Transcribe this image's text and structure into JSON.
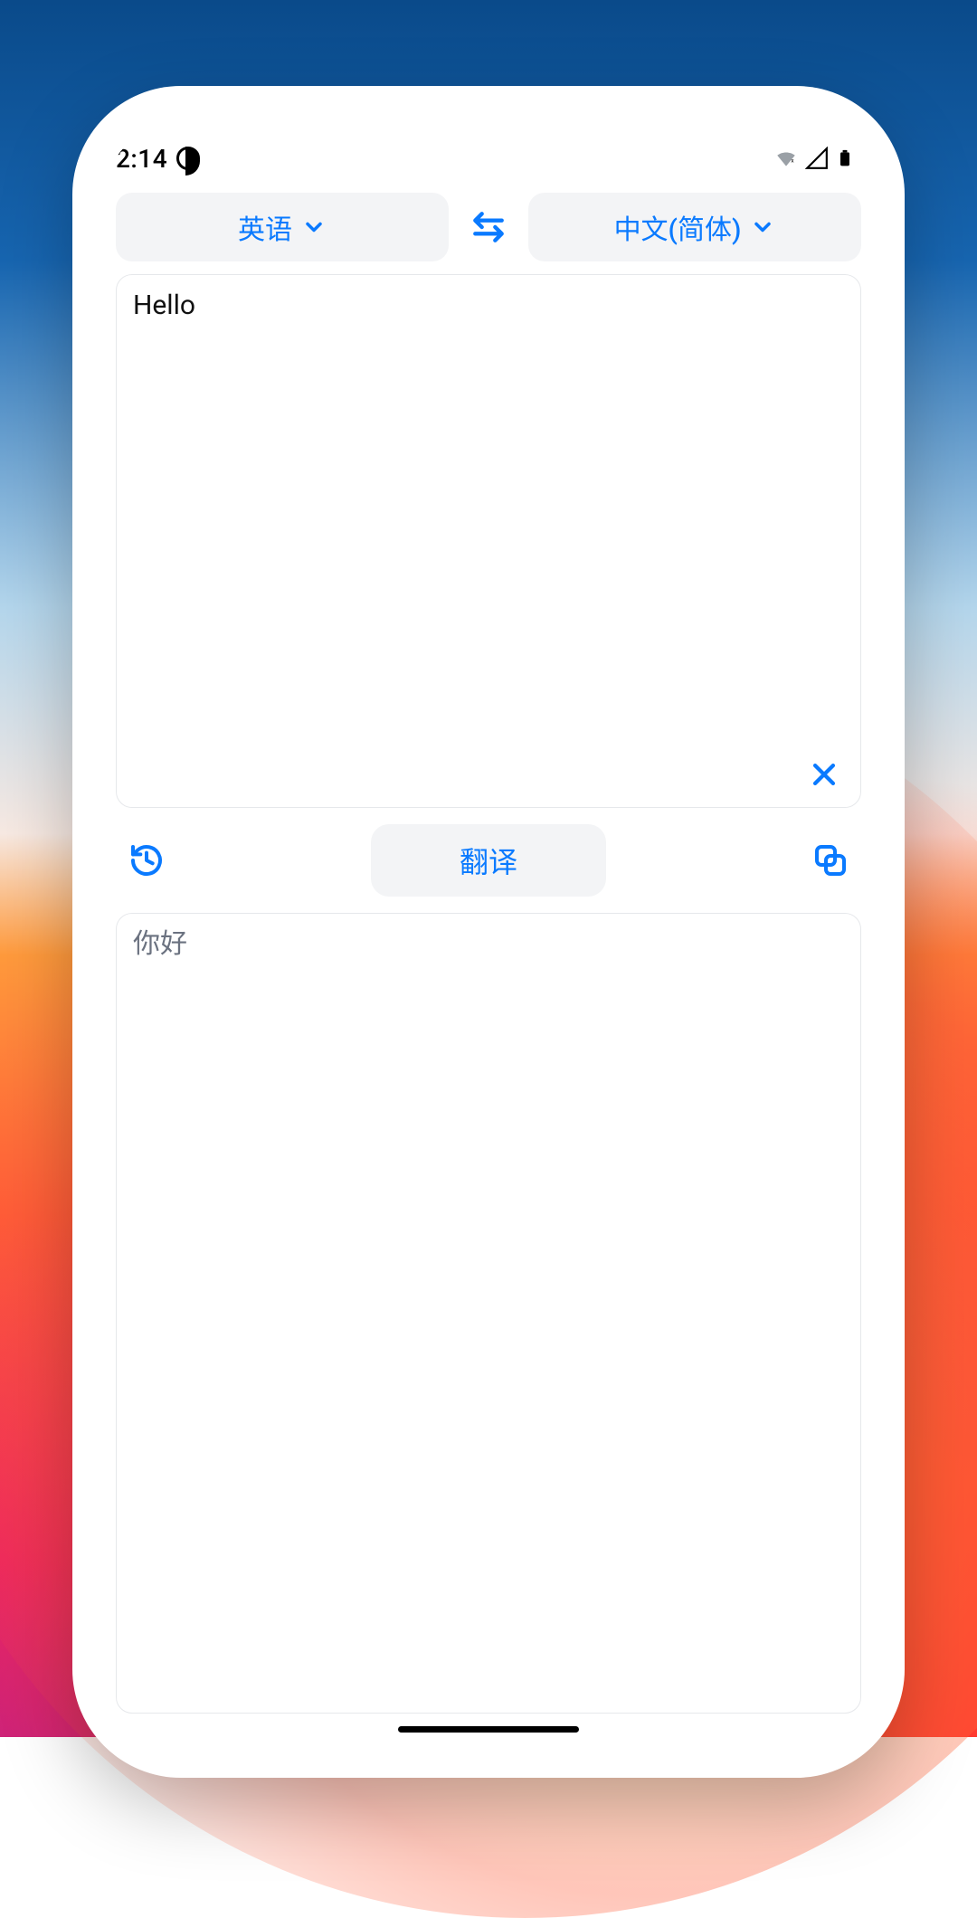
{
  "statusbar": {
    "time": "2:14"
  },
  "languages": {
    "source_label": "英语",
    "target_label": "中文(简体)"
  },
  "input": {
    "text": "Hello"
  },
  "actions": {
    "translate_label": "翻译"
  },
  "output": {
    "text": "你好"
  },
  "colors": {
    "accent": "#0a7aff",
    "panel_border": "#e6e8eb",
    "muted": "#6b7280",
    "pill": "#f3f4f6"
  }
}
